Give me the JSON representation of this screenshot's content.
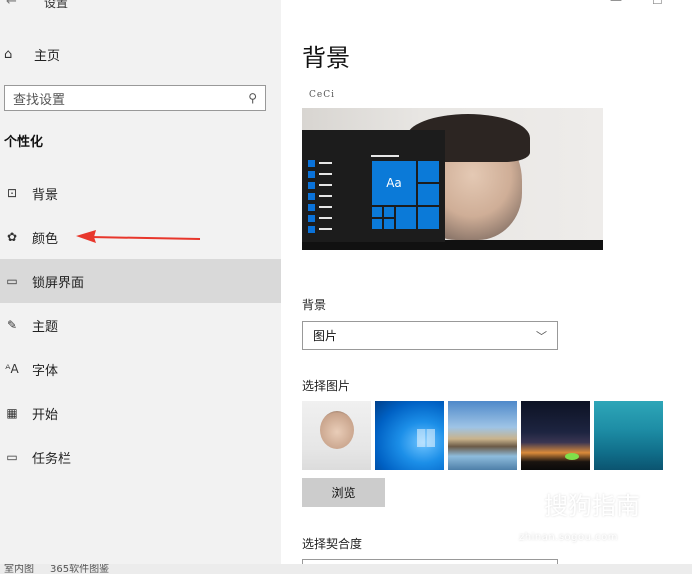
{
  "window": {
    "title": "设置",
    "back_glyph": "←",
    "minimize_glyph": "—",
    "maximize_glyph": "☐"
  },
  "sidebar": {
    "home_label": "主页",
    "search_placeholder": "查找设置",
    "section_title": "个性化",
    "items": [
      {
        "label": "背景",
        "icon": "picture-icon",
        "glyph": "⊡",
        "active": false
      },
      {
        "label": "颜色",
        "icon": "palette-icon",
        "glyph": "✿",
        "active": false
      },
      {
        "label": "锁屏界面",
        "icon": "lock-screen-icon",
        "glyph": "▭",
        "active": true
      },
      {
        "label": "主题",
        "icon": "brush-icon",
        "glyph": "✎",
        "active": false
      },
      {
        "label": "字体",
        "icon": "font-icon",
        "glyph": "ᴬA",
        "active": false
      },
      {
        "label": "开始",
        "icon": "start-menu-icon",
        "glyph": "▦",
        "active": false
      },
      {
        "label": "任务栏",
        "icon": "taskbar-icon",
        "glyph": "▭",
        "active": false
      }
    ]
  },
  "main": {
    "title": "背景",
    "preview": {
      "banner_text": "CeCi",
      "tile_text": "Aa"
    },
    "background_label": "背景",
    "background_value": "图片",
    "choose_picture_label": "选择图片",
    "browse_label": "浏览",
    "fit_label": "选择契合度"
  },
  "watermark": {
    "text": "搜狗指南",
    "icon_glyph": "S",
    "url": "zhinan.sogou.com"
  },
  "bottom_strip": {
    "left_text": "室内图",
    "mid_text": "365软件图鉴"
  },
  "colors": {
    "accent": "#0b7ad8",
    "sidebar_bg": "#f2f2f2",
    "active_item_bg": "#d9d9d9",
    "arrow": "#e8372c"
  }
}
